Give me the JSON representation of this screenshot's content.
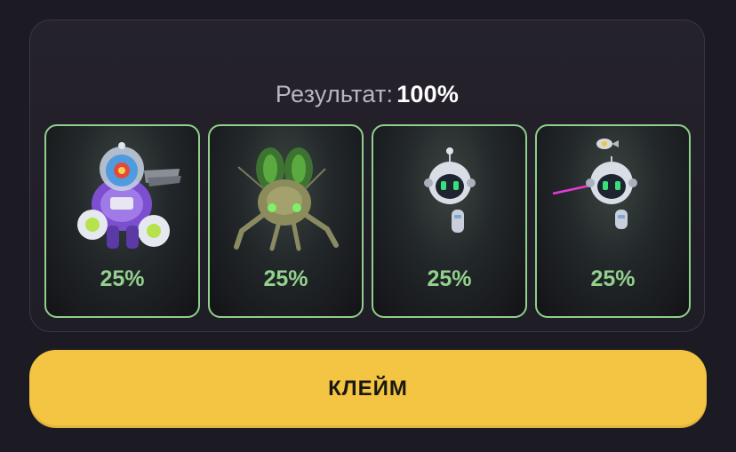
{
  "result": {
    "label": "Результат:",
    "value": "100%"
  },
  "cards": [
    {
      "icon": "purple-mech-robot-icon",
      "chance": "25%"
    },
    {
      "icon": "green-mech-bug-icon",
      "chance": "25%"
    },
    {
      "icon": "round-drone-robot-icon",
      "chance": "25%"
    },
    {
      "icon": "laser-drone-robot-icon",
      "chance": "25%"
    }
  ],
  "claim_button": {
    "label": "КЛЕЙМ"
  },
  "colors": {
    "background": "#1c1a22",
    "card_border": "#8fd08a",
    "percent_text": "#93d18c",
    "button": "#f4c443"
  }
}
